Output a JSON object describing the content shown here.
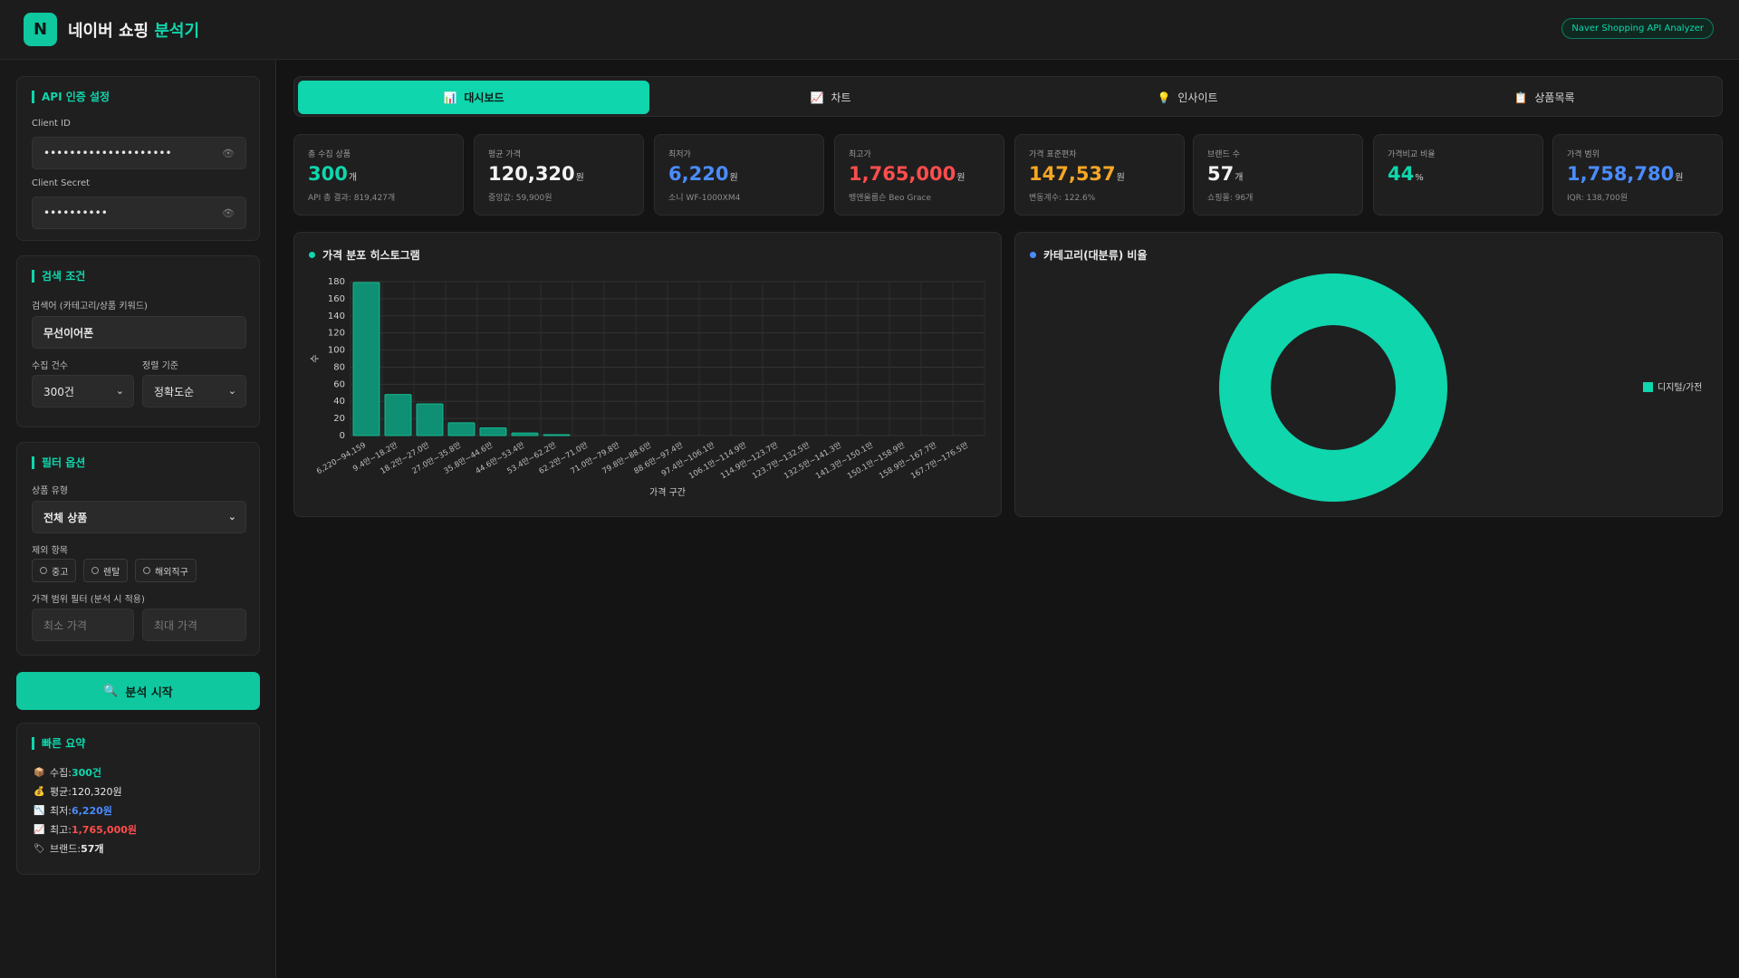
{
  "header": {
    "logo_letter": "N",
    "title_main": "네이버 쇼핑 ",
    "title_accent": "분석기",
    "badge": "Naver Shopping API Analyzer"
  },
  "auth": {
    "title": "API 인증 설정",
    "client_id_label": "Client ID",
    "client_id_value": "••••••••••••••••••••",
    "client_secret_label": "Client Secret",
    "client_secret_value": "••••••••••"
  },
  "search": {
    "title": "검색 조건",
    "keyword_label": "검색어 (카테고리/상품 키워드)",
    "keyword_value": "무선이어폰",
    "count_label": "수집 건수",
    "count_value": "300건",
    "sort_label": "정렬 기준",
    "sort_value": "정확도순"
  },
  "filter": {
    "title": "필터 옵션",
    "product_type_label": "상품 유형",
    "product_type_value": "전체 상품",
    "exclude_label": "제외 항목",
    "exclude_options": [
      "중고",
      "렌탈",
      "해외직구"
    ],
    "price_range_label": "가격 범위 필터 (분석 시 적용)",
    "min_price_placeholder": "최소 가격",
    "max_price_placeholder": "최대 가격"
  },
  "analyze_button": "분석 시작",
  "summary": {
    "title": "빠른 요약",
    "items": [
      {
        "icon": "box-icon",
        "label": "수집: ",
        "value": "300건",
        "color": "#0fd6ac"
      },
      {
        "icon": "money-bag-icon",
        "label": "평균: ",
        "value": "120,320원",
        "color": "#e8e8e8"
      },
      {
        "icon": "chart-down-icon",
        "label": "최저: ",
        "value": "6,220원",
        "color": "#4a8cff"
      },
      {
        "icon": "chart-up-icon",
        "label": "최고: ",
        "value": "1,765,000원",
        "color": "#ff4d4d"
      },
      {
        "icon": "tag-icon",
        "label": "브랜드: ",
        "value": "57개",
        "color": "#e8e8e8"
      }
    ]
  },
  "tabs": [
    {
      "icon": "bar-chart-icon",
      "label": "대시보드",
      "active": true
    },
    {
      "icon": "line-chart-icon",
      "label": "차트",
      "active": false
    },
    {
      "icon": "bulb-icon",
      "label": "인사이트",
      "active": false
    },
    {
      "icon": "clipboard-icon",
      "label": "상품목록",
      "active": false
    }
  ],
  "stats": [
    {
      "label": "총 수집 상품",
      "value": "300",
      "unit": "개",
      "sub": "API 총 결과: 819,427개",
      "color": "#0fd6ac"
    },
    {
      "label": "평균 가격",
      "value": "120,320",
      "unit": "원",
      "sub": "중앙값: 59,900원",
      "color": "#f2f2f2"
    },
    {
      "label": "최저가",
      "value": "6,220",
      "unit": "원",
      "sub": "소니 WF-1000XM4",
      "color": "#4a8cff"
    },
    {
      "label": "최고가",
      "value": "1,765,000",
      "unit": "원",
      "sub": "뱅앤올룹슨 Beo Grace",
      "color": "#ff4d4d"
    },
    {
      "label": "가격 표준편차",
      "value": "147,537",
      "unit": "원",
      "sub": "변동계수: 122.6%",
      "color": "#f5a623"
    },
    {
      "label": "브랜드 수",
      "value": "57",
      "unit": "개",
      "sub": "쇼핑몰: 96개",
      "color": "#f2f2f2"
    },
    {
      "label": "가격비교 비율",
      "value": "44",
      "unit": "%",
      "sub": "",
      "color": "#0fd6ac"
    },
    {
      "label": "가격 범위",
      "value": "1,758,780",
      "unit": "원",
      "sub": "IQR: 138,700원",
      "color": "#4a8cff"
    }
  ],
  "histogram": {
    "title": "가격 분포 히스토그램",
    "dot_color": "#0fd6ac"
  },
  "donut": {
    "title": "카테고리(대분류) 비율",
    "dot_color": "#4a8cff"
  },
  "chart_data": [
    {
      "type": "bar",
      "title": "가격 분포 히스토그램",
      "xlabel": "가격 구간",
      "ylabel": "수",
      "ylim": [
        0,
        180
      ],
      "yticks": [
        0,
        20,
        40,
        60,
        80,
        100,
        120,
        140,
        160,
        180
      ],
      "grid": true,
      "categories": [
        "6,220~94,159",
        "9.4만~18.2만",
        "18.2만~27.0만",
        "27.0만~35.8만",
        "35.8만~44.6만",
        "44.6만~53.4만",
        "53.4만~62.2만",
        "62.2만~71.0만",
        "71.0만~79.8만",
        "79.8만~88.6만",
        "88.6만~97.4만",
        "97.4만~106.1만",
        "106.1만~114.9만",
        "114.9만~123.7만",
        "123.7만~132.5만",
        "132.5만~141.3만",
        "141.3만~150.1만",
        "150.1만~158.9만",
        "158.9만~167.7만",
        "167.7만~176.5만"
      ],
      "values": [
        179,
        48,
        37,
        15,
        9,
        3,
        1,
        0,
        0,
        0,
        0,
        0,
        0,
        0,
        0,
        0,
        0,
        0,
        0,
        0
      ],
      "color": "#0f8f73"
    },
    {
      "type": "pie",
      "title": "카테고리(대분류) 비율",
      "labels": [
        "디지털/가전"
      ],
      "values": [
        100
      ],
      "colors": [
        "#0fd6ac"
      ],
      "legend": "right"
    }
  ]
}
